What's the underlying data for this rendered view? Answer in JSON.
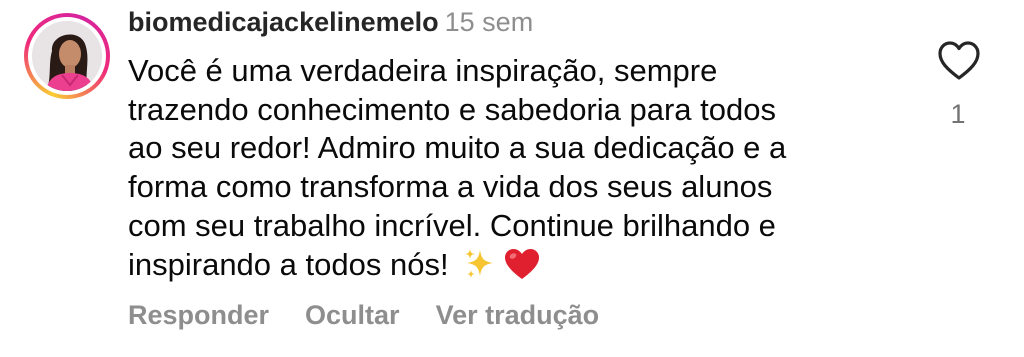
{
  "comment": {
    "username": "biomedicajackelinemelo",
    "time": "15 sem",
    "text_lines": [
      "Você é uma verdadeira inspiração, sempre",
      "trazendo conhecimento e sabedoria para todos",
      "ao seu redor! Admiro muito a sua dedicação e a",
      "forma como transforma a vida dos seus alunos",
      "com seu trabalho incrível. Continue brilhando e",
      "inspirando a todos nós!"
    ],
    "emojis": [
      "sparkles",
      "red-heart"
    ],
    "likes": "1"
  },
  "actions": {
    "reply": "Responder",
    "hide": "Ocultar",
    "translate": "Ver tradução"
  },
  "icons": {
    "like": "heart-outline-icon"
  },
  "colors": {
    "username": "#262626",
    "secondary": "#8e8e8e",
    "text": "#0a0a0a",
    "heart": "#e0202e",
    "sparkles": "#f7c531"
  }
}
